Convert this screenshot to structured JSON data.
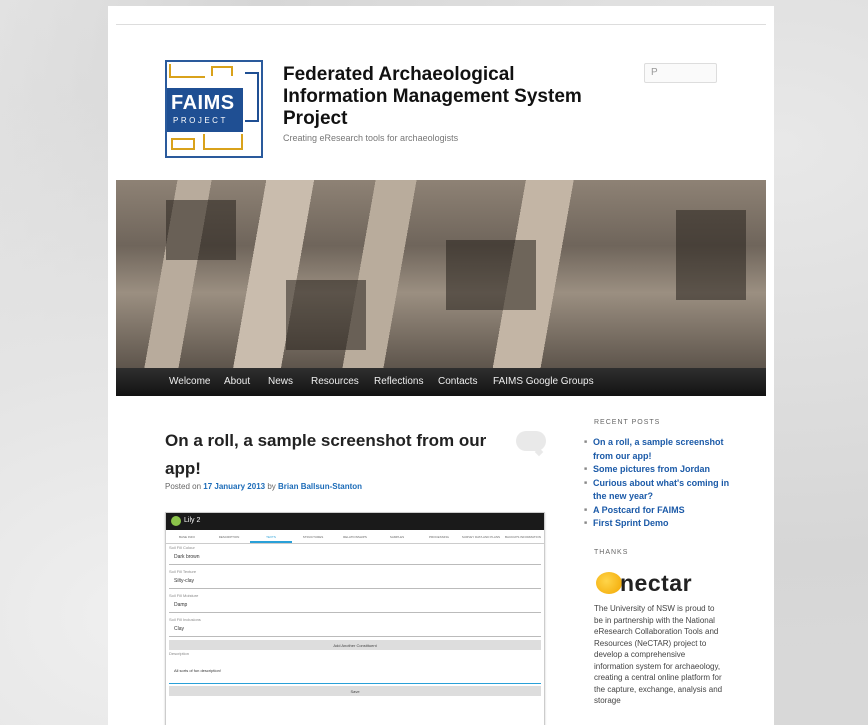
{
  "site": {
    "title": "Federated Archaeological Information Management System Project",
    "tagline": "Creating eResearch tools for archaeologists",
    "logo_main": "FAIMS",
    "logo_sub": "PROJECT",
    "search_placeholder": "P"
  },
  "nav": [
    "Welcome",
    "About",
    "News",
    "Resources",
    "Reflections",
    "Contacts",
    "FAIMS Google Groups"
  ],
  "post": {
    "title": "On a roll, a sample screenshot from our app!",
    "posted_on": "Posted on",
    "date": "17 January 2013",
    "by": "by",
    "author": "Brian Ballsun-Stanton"
  },
  "app_screenshot": {
    "user": "Lily 2",
    "tabs": [
      "BASE INFO",
      "DESCRIPTION",
      "TEXTS",
      "STRUCTURES",
      "RELATIONSHIPS",
      "SAMPLES",
      "PROCESSING",
      "SURVEY DATA AND PLANS",
      "BACKUPS INFORMATION"
    ],
    "fields": [
      {
        "label": "Soil Fill Colour",
        "value": "Dark brown"
      },
      {
        "label": "Soil Fill Texture",
        "value": "Silty-clay"
      },
      {
        "label": "Soil Fill Moisture",
        "value": "Damp"
      },
      {
        "label": "Soil Fill Inclusions",
        "value": "Clay"
      }
    ],
    "add_button": "Add Another Constituent",
    "description_label": "Description",
    "description_value": "All sorts of fun description!",
    "save_button": "Save"
  },
  "sidebar": {
    "recent_heading": "RECENT POSTS",
    "recent_posts": [
      "On a roll, a sample screenshot from our app!",
      "Some pictures from Jordan",
      "Curious about what's coming in the new year?",
      "A Postcard for FAIMS",
      "First Sprint Demo"
    ],
    "thanks_heading": "THANKS",
    "sponsor_logo": "nectar",
    "thanks_text": "The University of NSW is proud to be in partnership with the National eResearch Collaboration Tools and Resources (NeCTAR) project to develop a comprehensive information system for archaeology, creating a central online platform for the capture, exchange, analysis and storage"
  },
  "colors": {
    "link": "#1b5aa8",
    "nav_bg": "#1a1a1a",
    "logo_blue": "#1f4f93",
    "accent_gold": "#d9a21b"
  }
}
